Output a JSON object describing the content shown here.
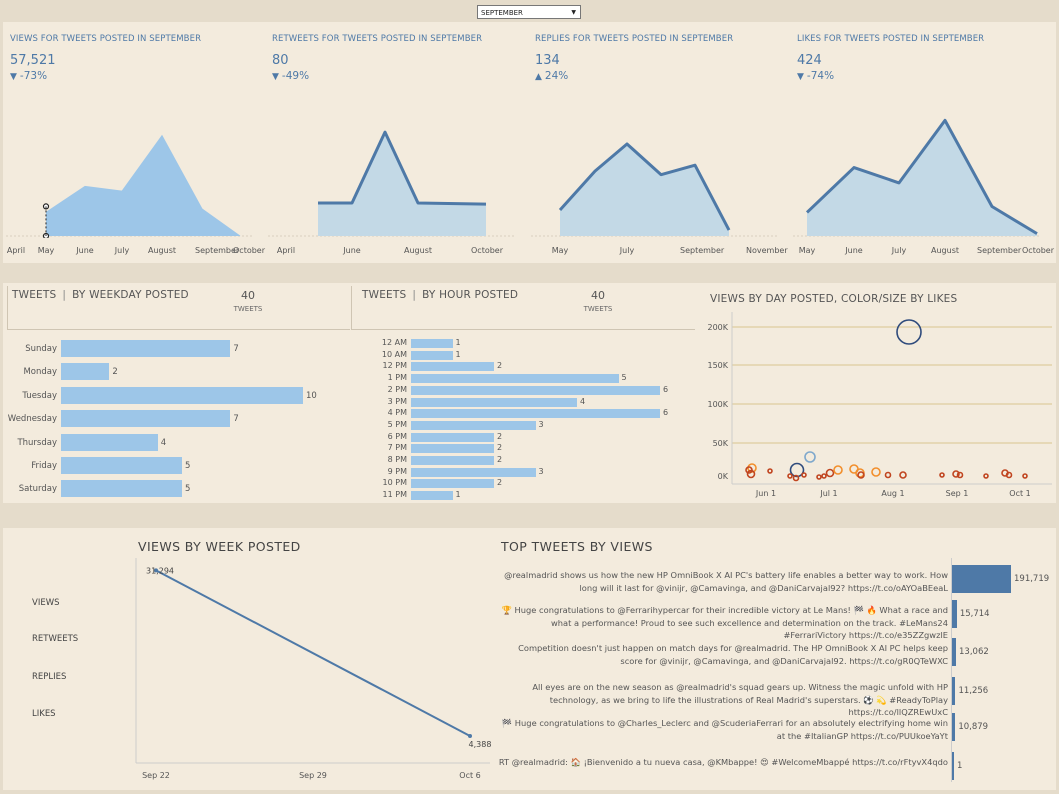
{
  "filter": {
    "selected": "SEPTEMBER"
  },
  "kpis": [
    {
      "title": "VIEWS FOR TWEETS POSTED IN SEPTEMBER",
      "value": "57,521",
      "arrow": "▼",
      "change": "-73%",
      "x_labels": [
        "April",
        "May",
        "June",
        "July",
        "August",
        "September",
        "October"
      ],
      "series": [
        {
          "x": "May",
          "y": 0.2
        },
        {
          "x": "June",
          "y": 0.42
        },
        {
          "x": "July",
          "y": 0.38
        },
        {
          "x": "August",
          "y": 0.85
        },
        {
          "x": "September",
          "y": 0.23
        },
        {
          "x": "October",
          "y": 0.0
        }
      ]
    },
    {
      "title": "RETWEETS FOR TWEETS POSTED IN SEPTEMBER",
      "value": "80",
      "arrow": "▼",
      "change": "-49%",
      "x_labels": [
        "April",
        "June",
        "August",
        "October"
      ],
      "series": [
        {
          "x": "May",
          "y": 0.28
        },
        {
          "x": "June",
          "y": 0.28
        },
        {
          "x": "July",
          "y": 0.88
        },
        {
          "x": "August",
          "y": 0.28
        },
        {
          "x": "October",
          "y": 0.27
        }
      ]
    },
    {
      "title": "REPLIES FOR TWEETS POSTED IN SEPTEMBER",
      "value": "134",
      "arrow": "▲",
      "change": "24%",
      "x_labels": [
        "May",
        "July",
        "September",
        "November"
      ],
      "series": [
        {
          "x": "May",
          "y": 0.22
        },
        {
          "x": "June",
          "y": 0.55
        },
        {
          "x": "July",
          "y": 0.78
        },
        {
          "x": "August",
          "y": 0.52
        },
        {
          "x": "September",
          "y": 0.6
        },
        {
          "x": "October",
          "y": 0.05
        }
      ]
    },
    {
      "title": "LIKES FOR TWEETS POSTED IN SEPTEMBER",
      "value": "424",
      "arrow": "▼",
      "change": "-74%",
      "x_labels": [
        "May",
        "June",
        "July",
        "August",
        "September",
        "October"
      ],
      "series": [
        {
          "x": "May",
          "y": 0.2
        },
        {
          "x": "June",
          "y": 0.58
        },
        {
          "x": "July",
          "y": 0.45
        },
        {
          "x": "August",
          "y": 0.98
        },
        {
          "x": "September",
          "y": 0.25
        },
        {
          "x": "October",
          "y": 0.02
        }
      ]
    }
  ],
  "weekday": {
    "title_a": "TWEETS",
    "title_b": "BY WEEKDAY POSTED",
    "count": "40",
    "count_label": "TWEETS",
    "rows": [
      {
        "label": "Sunday",
        "value": 7
      },
      {
        "label": "Monday",
        "value": 2
      },
      {
        "label": "Tuesday",
        "value": 10
      },
      {
        "label": "Wednesday",
        "value": 7
      },
      {
        "label": "Thursday",
        "value": 4
      },
      {
        "label": "Friday",
        "value": 5
      },
      {
        "label": "Saturday",
        "value": 5
      }
    ]
  },
  "hourly": {
    "title_a": "TWEETS",
    "title_b": "BY HOUR POSTED",
    "count": "40",
    "count_label": "TWEETS",
    "rows": [
      {
        "label": "12 AM",
        "value": 1
      },
      {
        "label": "10 AM",
        "value": 1
      },
      {
        "label": "12 PM",
        "value": 2
      },
      {
        "label": "1 PM",
        "value": 5
      },
      {
        "label": "2 PM",
        "value": 6
      },
      {
        "label": "3 PM",
        "value": 4
      },
      {
        "label": "4 PM",
        "value": 6
      },
      {
        "label": "5 PM",
        "value": 3
      },
      {
        "label": "6 PM",
        "value": 2
      },
      {
        "label": "7 PM",
        "value": 2
      },
      {
        "label": "8 PM",
        "value": 2
      },
      {
        "label": "9 PM",
        "value": 3
      },
      {
        "label": "10 PM",
        "value": 2
      },
      {
        "label": "11 PM",
        "value": 1
      }
    ]
  },
  "scatter": {
    "title": "VIEWS BY DAY POSTED, COLOR/SIZE BY LIKES",
    "y_ticks": [
      "200K",
      "150K",
      "100K",
      "50K",
      "0K"
    ],
    "x_ticks": [
      "Jun 1",
      "Jul 1",
      "Aug 1",
      "Sep 1",
      "Oct 1"
    ]
  },
  "chart_data": [
    {
      "type": "line",
      "title": "VIEWS BY WEEK POSTED",
      "x": [
        "Sep 22",
        "Sep 29",
        "Oct 6"
      ],
      "series": [
        {
          "values": [
            31294,
            null,
            4388
          ]
        }
      ],
      "data_labels": [
        "31,294",
        "4,388"
      ]
    },
    {
      "type": "bar",
      "title": "TOP TWEETS BY VIEWS",
      "values": [
        191719,
        15714,
        13062,
        11256,
        10879,
        1
      ],
      "data_labels": [
        "191,719",
        "15,714",
        "13,062",
        "11,256",
        "10,879",
        "1"
      ]
    }
  ],
  "weekly": {
    "title": "VIEWS BY WEEK POSTED",
    "metrics": [
      "VIEWS",
      "RETWEETS",
      "REPLIES",
      "LIKES"
    ],
    "x_labels": [
      "Sep 22",
      "Sep 29",
      "Oct 6"
    ],
    "start_label": "31,294",
    "end_label": "4,388"
  },
  "top_tweets": {
    "title": "TOP TWEETS BY VIEWS",
    "rows": [
      {
        "text": "@realmadrid shows us how the new HP OmniBook X AI PC's battery life enables a better way to work. How long will it last for @vinijr, @Camavinga, and @DaniCarvajal92? https://t.co/oAYOaBEeaL",
        "value": 191719,
        "label": "191,719"
      },
      {
        "text": "🏆 Huge congratulations to @Ferrarihypercar for their incredible victory at Le Mans! 🏁 🔥 What a race and what a performance! Proud to see such excellence and determination on the track. #LeMans24 #FerrariVictory https://t.co/e35ZZgwzlE",
        "value": 15714,
        "label": "15,714"
      },
      {
        "text": "Competition doesn't just happen on match days for @realmadrid. The HP OmniBook X AI PC helps keep score for @vinijr, @Camavinga, and @DaniCarvajal92. https://t.co/gR0QTeWXC",
        "value": 13062,
        "label": "13,062"
      },
      {
        "text": "All eyes are on the new season as @realmadrid's squad gears up. Witness the magic unfold with HP technology, as we bring to life the illustrations of Real Madrid's superstars. ⚽ 💫 #ReadyToPlay https://t.co/llQZREwUxC",
        "value": 11256,
        "label": "11,256"
      },
      {
        "text": "🏁 Huge congratulations to @Charles_Leclerc and @ScuderiaFerrari for an absolutely electrifying home win at the #ItalianGP https://t.co/PUUkoeYaYt",
        "value": 10879,
        "label": "10,879"
      },
      {
        "text": "RT @realmadrid: 🏠 ¡Bienvenido a tu nueva casa, @KMbappe! 😍 #WelcomeMbappé https://t.co/rFtyvX4qdo",
        "value": 1,
        "label": "1"
      }
    ]
  },
  "colors": {
    "bar": "#9dc6e8",
    "line": "#4e79a7",
    "area": "#a9cbe6",
    "bg": "#f3ebdd",
    "orange": "#f28e2b",
    "red": "#c0441f"
  }
}
